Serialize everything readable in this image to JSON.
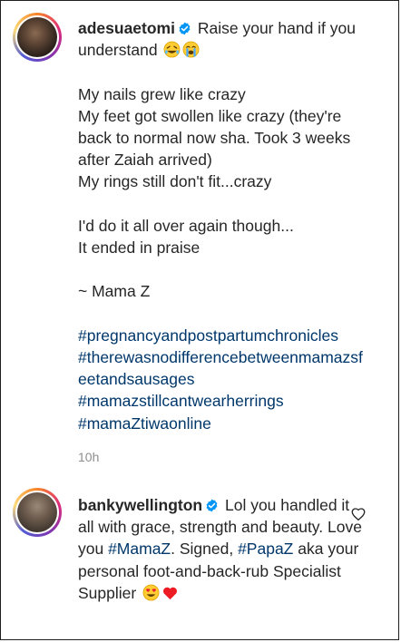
{
  "comments": [
    {
      "username": "adesuaetomi",
      "verified": true,
      "first_line": "Raise your hand if you understand",
      "emojis": [
        "rolling-on-floor-laughing-emoji",
        "loudly-crying-emoji"
      ],
      "lines": [
        "My nails grew like crazy",
        "My feet got swollen like crazy (they're back to normal now sha. Took 3 weeks after Zaiah arrived)",
        "My rings still don't fit...crazy",
        "I'd do it all over again though...",
        "It ended in praise",
        "~ Mama Z"
      ],
      "hashtags": [
        "#pregnancyandpostpartumchronicles",
        "#therewasnodifferencebetweenmamazsfeetandsausages",
        "#mamazstillcantwearherrings",
        "#mamaZtiwaonline"
      ],
      "time": "10h"
    },
    {
      "username": "bankywellington",
      "verified": true,
      "text_1": "Lol you handled it all with grace, strength and beauty. Love you ",
      "tag_1": "#MamaZ",
      "text_2": ". Signed, ",
      "tag_2": "#PapaZ",
      "text_3": " aka your personal foot-and-back-rub Specialist Supplier",
      "emojis": [
        "heart-eyes-emoji",
        "red-heart-emoji"
      ],
      "like_icon": "heart-outline-icon"
    }
  ],
  "colors": {
    "text": "#262626",
    "hashtag": "#00376b",
    "meta": "#8e8e8e",
    "verified": "#0095f6",
    "heart": "#ed1c24"
  }
}
